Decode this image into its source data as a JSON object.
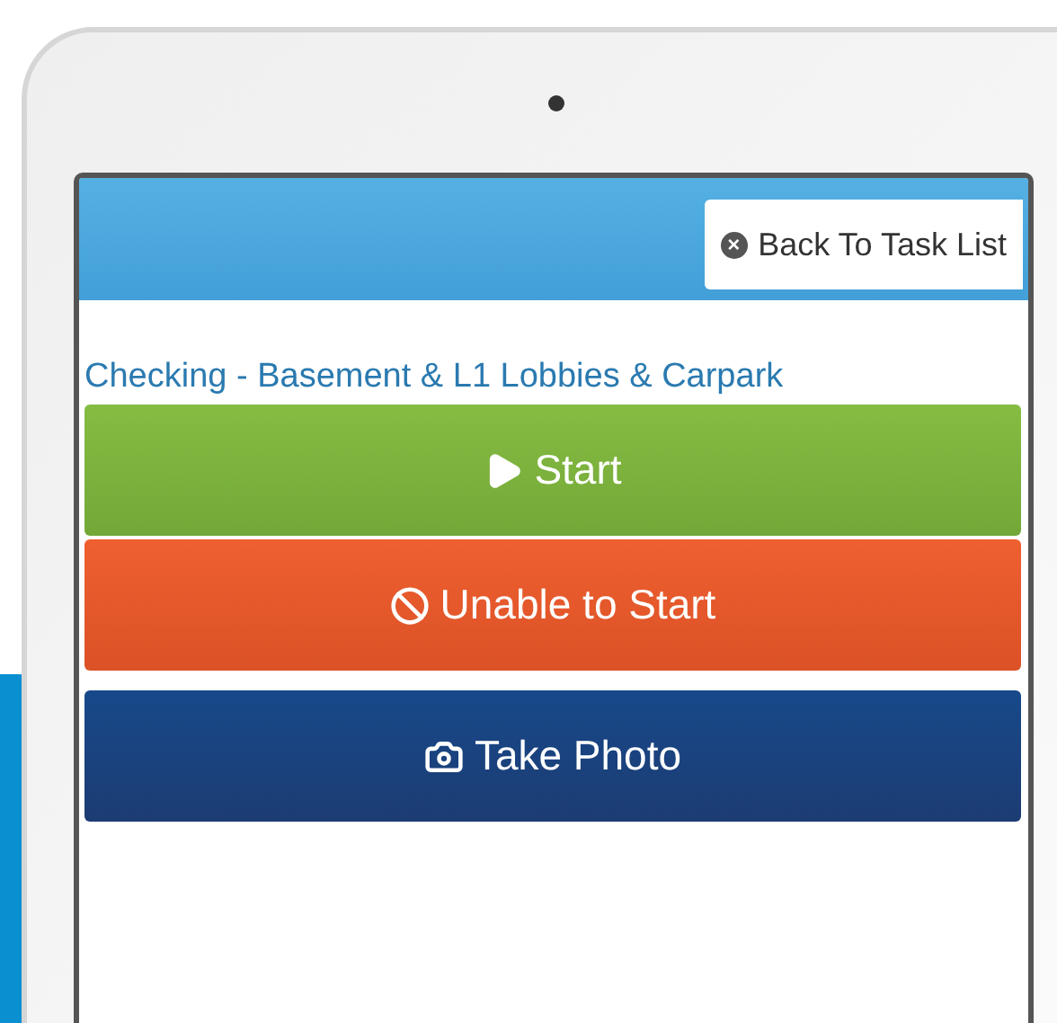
{
  "header": {
    "back_button": {
      "icon": "×",
      "label": "Back To Task List"
    }
  },
  "task_title": "Checking - Basement & L1 Lobbies & Carpark",
  "actions": [
    {
      "kind": "start",
      "label": "Start"
    },
    {
      "kind": "unable",
      "label": "Unable to Start"
    },
    {
      "kind": "photo",
      "label": "Take Photo"
    }
  ]
}
